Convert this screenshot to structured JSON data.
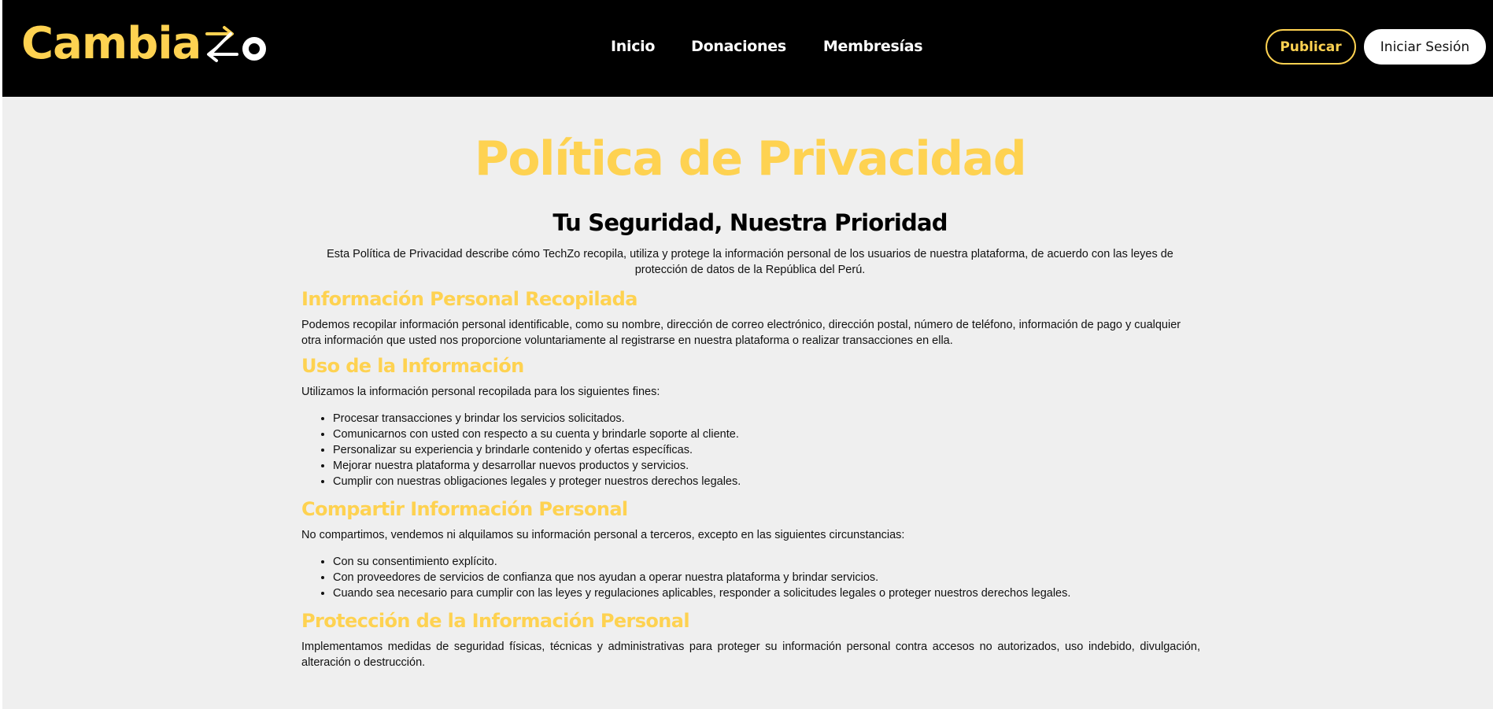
{
  "header": {
    "logo_text": "Cambia",
    "nav": [
      "Inicio",
      "Donaciones",
      "Membresías"
    ],
    "publish_label": "Publicar",
    "login_label": "Iniciar Sesión"
  },
  "main": {
    "title": "Política de Privacidad",
    "subtitle": "Tu Seguridad, Nuestra Prioridad",
    "intro": "Esta Política de Privacidad describe cómo TechZo recopila, utiliza y protege la información personal de los usuarios de nuestra plataforma, de acuerdo con las leyes de protección de datos de la República del Perú.",
    "sections": [
      {
        "heading": "Información Personal Recopilada",
        "paragraph": "Podemos recopilar información personal identificable, como su nombre, dirección de correo electrónico, dirección postal, número de teléfono, información de pago y cualquier otra información que usted nos proporcione voluntariamente al registrarse en nuestra plataforma o realizar transacciones en ella."
      },
      {
        "heading": "Uso de la Información",
        "paragraph": "Utilizamos la información personal recopilada para los siguientes fines:",
        "items": [
          "Procesar transacciones y brindar los servicios solicitados.",
          "Comunicarnos con usted con respecto a su cuenta y brindarle soporte al cliente.",
          "Personalizar su experiencia y brindarle contenido y ofertas específicas.",
          "Mejorar nuestra plataforma y desarrollar nuevos productos y servicios.",
          "Cumplir con nuestras obligaciones legales y proteger nuestros derechos legales."
        ]
      },
      {
        "heading": "Compartir Información Personal",
        "paragraph": "No compartimos, vendemos ni alquilamos su información personal a terceros, excepto en las siguientes circunstancias:",
        "items": [
          "Con su consentimiento explícito.",
          "Con proveedores de servicios de confianza que nos ayudan a operar nuestra plataforma y brindar servicios.",
          "Cuando sea necesario para cumplir con las leyes y regulaciones aplicables, responder a solicitudes legales o proteger nuestros derechos legales."
        ]
      },
      {
        "heading": "Protección de la Información Personal",
        "paragraph": "Implementamos medidas de seguridad físicas, técnicas y administrativas para proteger su información personal contra accesos no autorizados, uso indebido, divulgación, alteración o destrucción."
      }
    ]
  },
  "colors": {
    "accent": "#fed251",
    "header_bg": "#000000",
    "page_bg": "#efefef"
  }
}
